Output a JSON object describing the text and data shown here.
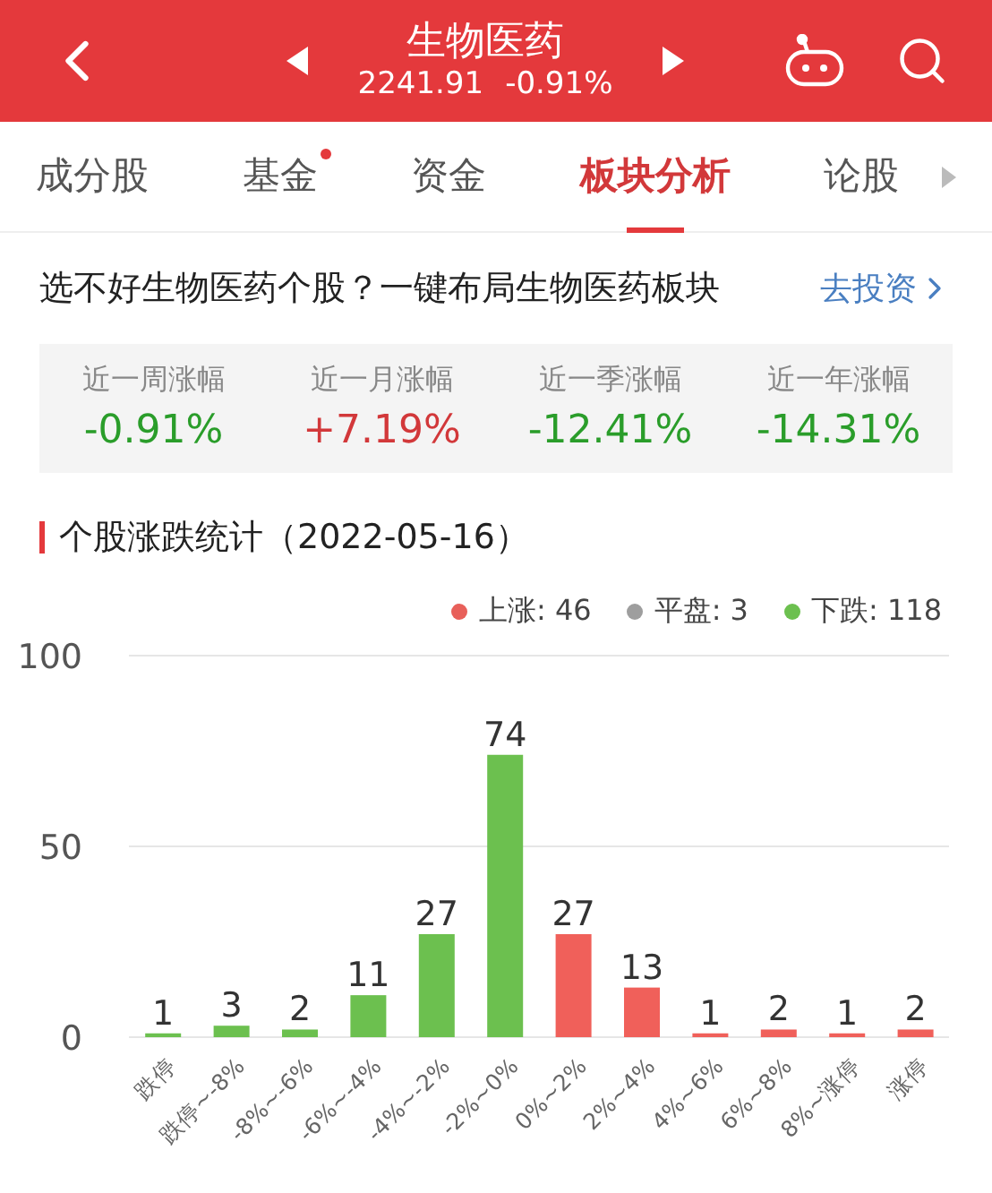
{
  "header": {
    "title": "生物医药",
    "price": "2241.91",
    "change": "-0.91%"
  },
  "tabs": [
    {
      "label": "成分股",
      "selected": false,
      "dot": false
    },
    {
      "label": "基金",
      "selected": false,
      "dot": true
    },
    {
      "label": "资金",
      "selected": false,
      "dot": false
    },
    {
      "label": "板块分析",
      "selected": true,
      "dot": false
    },
    {
      "label": "论股",
      "selected": false,
      "dot": false
    }
  ],
  "promo": {
    "text": "选不好生物医药个股？一键布局生物医药板块",
    "link": "去投资"
  },
  "stats": [
    {
      "label": "近一周涨幅",
      "value": "-0.91%",
      "color": "#2a9d2a"
    },
    {
      "label": "近一月涨幅",
      "value": "+7.19%",
      "color": "#d2383a"
    },
    {
      "label": "近一季涨幅",
      "value": "-12.41%",
      "color": "#2a9d2a"
    },
    {
      "label": "近一年涨幅",
      "value": "-14.31%",
      "color": "#2a9d2a"
    }
  ],
  "section_title": "个股涨跌统计（2022-05-16）",
  "legend": [
    {
      "label": "上涨: 46",
      "color": "#e8605a"
    },
    {
      "label": "平盘: 3",
      "color": "#9e9e9e"
    },
    {
      "label": "下跌: 118",
      "color": "#6cc04f"
    }
  ],
  "chart_data": {
    "type": "bar",
    "categories": [
      "跌停",
      "跌停~-8%",
      "-8%~-6%",
      "-6%~-4%",
      "-4%~-2%",
      "-2%~0%",
      "0%~2%",
      "2%~4%",
      "4%~6%",
      "6%~8%",
      "8%~涨停",
      "涨停"
    ],
    "series": [
      {
        "color": "#6cc04f",
        "values": [
          1,
          3,
          2,
          11,
          27,
          74,
          null,
          null,
          null,
          null,
          null,
          null
        ]
      },
      {
        "color": "#f0605a",
        "values": [
          null,
          null,
          null,
          null,
          null,
          null,
          27,
          13,
          1,
          2,
          1,
          2
        ]
      }
    ],
    "ylim": [
      0,
      100
    ],
    "yticks": [
      0,
      50,
      100
    ],
    "data_labels": true
  }
}
